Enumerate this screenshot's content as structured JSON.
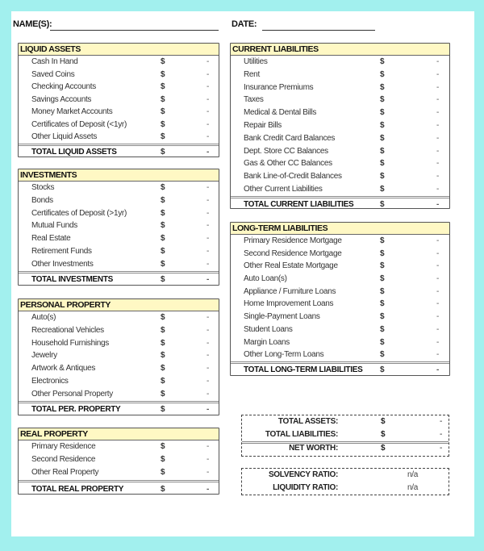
{
  "header": {
    "names_label": "NAME(S):",
    "date_label": "DATE:"
  },
  "liquid_assets": {
    "title": "LIQUID ASSETS",
    "items": [
      {
        "label": "Cash In Hand",
        "currency": "$",
        "value": "-"
      },
      {
        "label": "Saved Coins",
        "currency": "$",
        "value": "-"
      },
      {
        "label": "Checking Accounts",
        "currency": "$",
        "value": "-"
      },
      {
        "label": "Savings Accounts",
        "currency": "$",
        "value": "-"
      },
      {
        "label": "Money Market Accounts",
        "currency": "$",
        "value": "-"
      },
      {
        "label": "Certificates of Deposit (<1yr)",
        "currency": "$",
        "value": "-"
      },
      {
        "label": "Other Liquid Assets",
        "currency": "$",
        "value": "-"
      }
    ],
    "total": {
      "label": "TOTAL LIQUID ASSETS",
      "currency": "$",
      "value": "-"
    }
  },
  "investments": {
    "title": "INVESTMENTS",
    "items": [
      {
        "label": "Stocks",
        "currency": "$",
        "value": "-"
      },
      {
        "label": "Bonds",
        "currency": "$",
        "value": "-"
      },
      {
        "label": "Certificates of Deposit (>1yr)",
        "currency": "$",
        "value": "-"
      },
      {
        "label": "Mutual Funds",
        "currency": "$",
        "value": "-"
      },
      {
        "label": "Real Estate",
        "currency": "$",
        "value": "-"
      },
      {
        "label": "Retirement Funds",
        "currency": "$",
        "value": "-"
      },
      {
        "label": "Other Investments",
        "currency": "$",
        "value": "-"
      }
    ],
    "total": {
      "label": "TOTAL INVESTMENTS",
      "currency": "$",
      "value": "-"
    }
  },
  "personal_property": {
    "title": "PERSONAL PROPERTY",
    "items": [
      {
        "label": "Auto(s)",
        "currency": "$",
        "value": "-"
      },
      {
        "label": "Recreational Vehicles",
        "currency": "$",
        "value": "-"
      },
      {
        "label": "Household Furnishings",
        "currency": "$",
        "value": "-"
      },
      {
        "label": "Jewelry",
        "currency": "$",
        "value": "-"
      },
      {
        "label": "Artwork & Antiques",
        "currency": "$",
        "value": "-"
      },
      {
        "label": "Electronics",
        "currency": "$",
        "value": "-"
      },
      {
        "label": "Other Personal Property",
        "currency": "$",
        "value": "-"
      }
    ],
    "total": {
      "label": "TOTAL PER. PROPERTY",
      "currency": "$",
      "value": "-"
    }
  },
  "real_property": {
    "title": "REAL PROPERTY",
    "items": [
      {
        "label": "Primary Residence",
        "currency": "$",
        "value": "-"
      },
      {
        "label": "Second Residence",
        "currency": "$",
        "value": "-"
      },
      {
        "label": "Other Real Property",
        "currency": "$",
        "value": "-"
      }
    ],
    "total": {
      "label": "TOTAL REAL PROPERTY",
      "currency": "$",
      "value": "-"
    }
  },
  "current_liabilities": {
    "title": "CURRENT LIABILITIES",
    "items": [
      {
        "label": "Utilities",
        "currency": "$",
        "value": "-"
      },
      {
        "label": "Rent",
        "currency": "$",
        "value": "-"
      },
      {
        "label": "Insurance Premiums",
        "currency": "$",
        "value": "-"
      },
      {
        "label": "Taxes",
        "currency": "$",
        "value": "-"
      },
      {
        "label": "Medical & Dental Bills",
        "currency": "$",
        "value": "-"
      },
      {
        "label": "Repair Bills",
        "currency": "$",
        "value": "-"
      },
      {
        "label": "Bank Credit Card Balances",
        "currency": "$",
        "value": "-"
      },
      {
        "label": "Dept. Store CC Balances",
        "currency": "$",
        "value": "-"
      },
      {
        "label": "Gas & Other CC Balances",
        "currency": "$",
        "value": "-"
      },
      {
        "label": "Bank Line-of-Credit Balances",
        "currency": "$",
        "value": "-"
      },
      {
        "label": "Other Current Liabilities",
        "currency": "$",
        "value": "-"
      }
    ],
    "total": {
      "label": "TOTAL CURRENT LIABILITIES",
      "currency": "$",
      "value": "-"
    }
  },
  "long_term_liabilities": {
    "title": "LONG-TERM LIABILITIES",
    "items": [
      {
        "label": "Primary Residence Mortgage",
        "currency": "$",
        "value": "-"
      },
      {
        "label": "Second Residence Mortgage",
        "currency": "$",
        "value": "-"
      },
      {
        "label": "Other Real Estate Mortgage",
        "currency": "$",
        "value": "-"
      },
      {
        "label": "Auto Loan(s)",
        "currency": "$",
        "value": "-"
      },
      {
        "label": "Appliance / Furniture Loans",
        "currency": "$",
        "value": "-"
      },
      {
        "label": "Home Improvement Loans",
        "currency": "$",
        "value": "-"
      },
      {
        "label": "Single-Payment Loans",
        "currency": "$",
        "value": "-"
      },
      {
        "label": "Student Loans",
        "currency": "$",
        "value": "-"
      },
      {
        "label": "Margin Loans",
        "currency": "$",
        "value": "-"
      },
      {
        "label": "Other Long-Term Loans",
        "currency": "$",
        "value": "-"
      }
    ],
    "total": {
      "label": "TOTAL LONG-TERM LIABILITIES",
      "currency": "$",
      "value": "-"
    }
  },
  "summary": {
    "total_assets": {
      "label": "TOTAL ASSETS:",
      "currency": "$",
      "value": "-"
    },
    "total_liabilities": {
      "label": "TOTAL LIABILITIES:",
      "currency": "$",
      "value": "-"
    },
    "net_worth": {
      "label": "NET WORTH:",
      "currency": "$",
      "value": "-"
    }
  },
  "ratios": {
    "solvency": {
      "label": "SOLVENCY RATIO:",
      "value": "n/a"
    },
    "liquidity": {
      "label": "LIQUIDITY RATIO:",
      "value": "n/a"
    }
  },
  "colors": {
    "background": "#a2f0ee",
    "section_header": "#fff8c4"
  }
}
